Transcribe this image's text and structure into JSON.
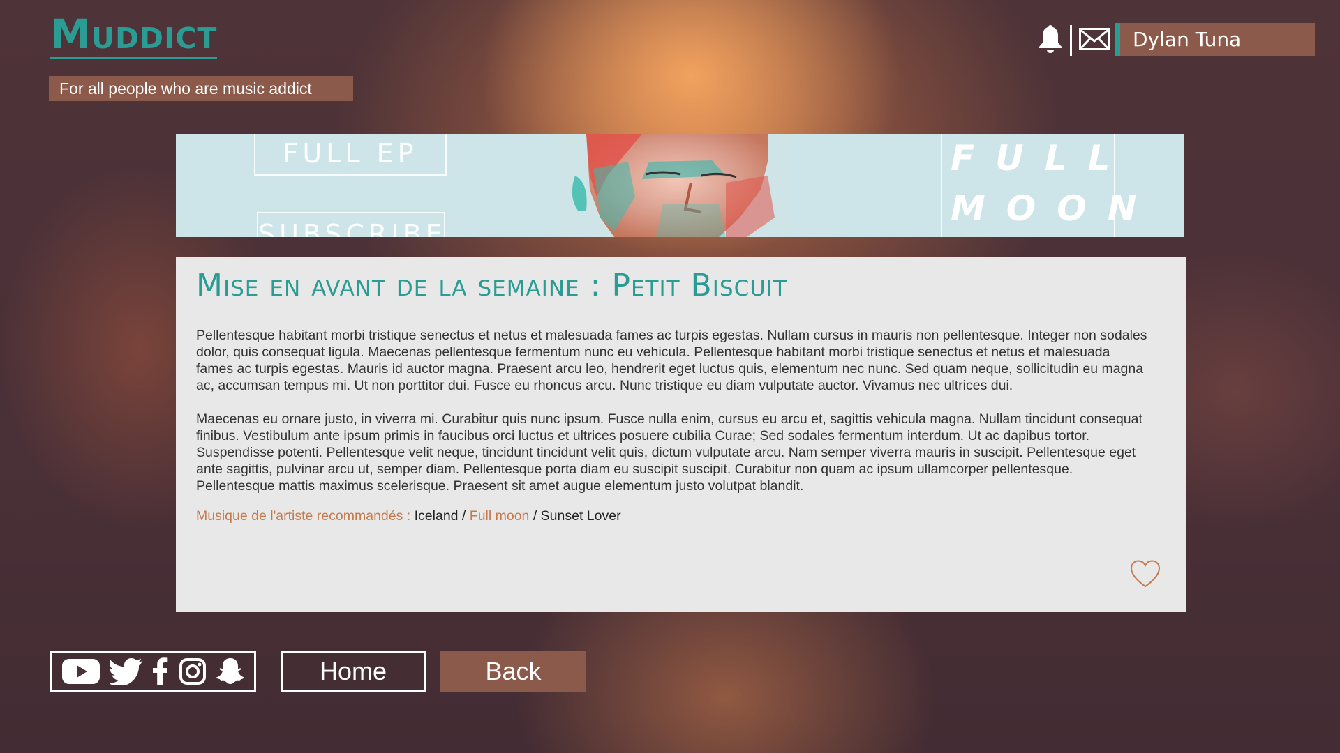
{
  "brand": {
    "logo": "Muddict",
    "tagline": "For all people who are music addict"
  },
  "header": {
    "username": "Dylan Tuna"
  },
  "banner": {
    "button1": "FULL EP",
    "button2": "SUBSCRIBE",
    "word1": "FULL",
    "word2": "MOON"
  },
  "article": {
    "title": "Mise en avant de la semaine : Petit Biscuit",
    "paragraph1": "Pellentesque habitant morbi tristique senectus et netus et malesuada fames ac turpis egestas. Nullam cursus in mauris non pellentesque. Integer non sodales dolor, quis consequat ligula. Maecenas pellentesque fermentum nunc eu vehicula. Pellentesque habitant morbi tristique senectus et netus et malesuada fames ac turpis egestas. Mauris id auctor magna. Praesent arcu leo, hendrerit eget luctus quis, elementum nec nunc. Sed quam neque, sollicitudin eu magna ac, accumsan tempus mi. Ut non porttitor dui. Fusce eu rhoncus arcu. Nunc tristique eu diam vulputate auctor. Vivamus nec ultrices dui.",
    "paragraph2": "Maecenas eu ornare justo, in viverra mi. Curabitur quis nunc ipsum. Fusce nulla enim, cursus eu arcu et, sagittis vehicula magna. Nullam tincidunt consequat finibus. Vestibulum ante ipsum primis in faucibus orci luctus et ultrices posuere cubilia Curae; Sed sodales fermentum interdum. Ut ac dapibus tortor. Suspendisse potenti. Pellentesque velit neque, tincidunt tincidunt velit quis, dictum vulputate arcu. Nam semper viverra mauris in suscipit. Pellentesque eget ante sagittis, pulvinar arcu ut, semper diam. Pellentesque porta diam eu suscipit suscipit. Curabitur non quam ac ipsum ullamcorper pellentesque. Pellentesque mattis maximus scelerisque. Praesent sit amet augue elementum justo volutpat blandit.",
    "recommend_label": "Musique de l'artiste recommandés :",
    "tracks": [
      "Iceland",
      "Full moon",
      "Sunset Lover"
    ],
    "separator": " / "
  },
  "footer": {
    "social_icons": [
      "youtube-icon",
      "twitter-icon",
      "facebook-icon",
      "instagram-icon",
      "snapchat-icon"
    ],
    "home_label": "Home",
    "back_label": "Back"
  },
  "colors": {
    "accent": "#2a9c94",
    "brand_brown": "#8b5a4a",
    "highlight": "#c57a4c"
  }
}
